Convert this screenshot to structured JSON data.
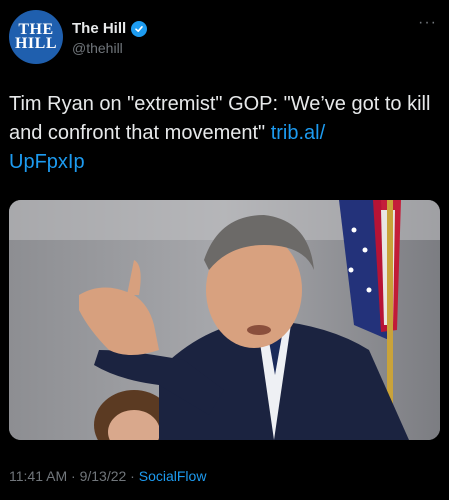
{
  "account": {
    "display_name": "The Hill",
    "handle": "@thehill",
    "avatar_line1": "THE",
    "avatar_line2": "HILL",
    "avatar_color": "#1f5fae",
    "verified": true
  },
  "tweet": {
    "text_prefix": "Tim Ryan on \"extremist\" GOP: \"We’ve got to kill and confront that movement\" ",
    "link_part1": "trib.al/",
    "link_part2": "UpFpxIp"
  },
  "meta": {
    "time": "11:41 AM",
    "separator1": " · ",
    "date": "9/13/22",
    "separator2": " · ",
    "source": "SocialFlow"
  },
  "more_icon": "more-horizontal-icon",
  "colors": {
    "background": "#000000",
    "text": "#e7e9ea",
    "secondary": "#71767b",
    "link": "#1d9bf0"
  }
}
